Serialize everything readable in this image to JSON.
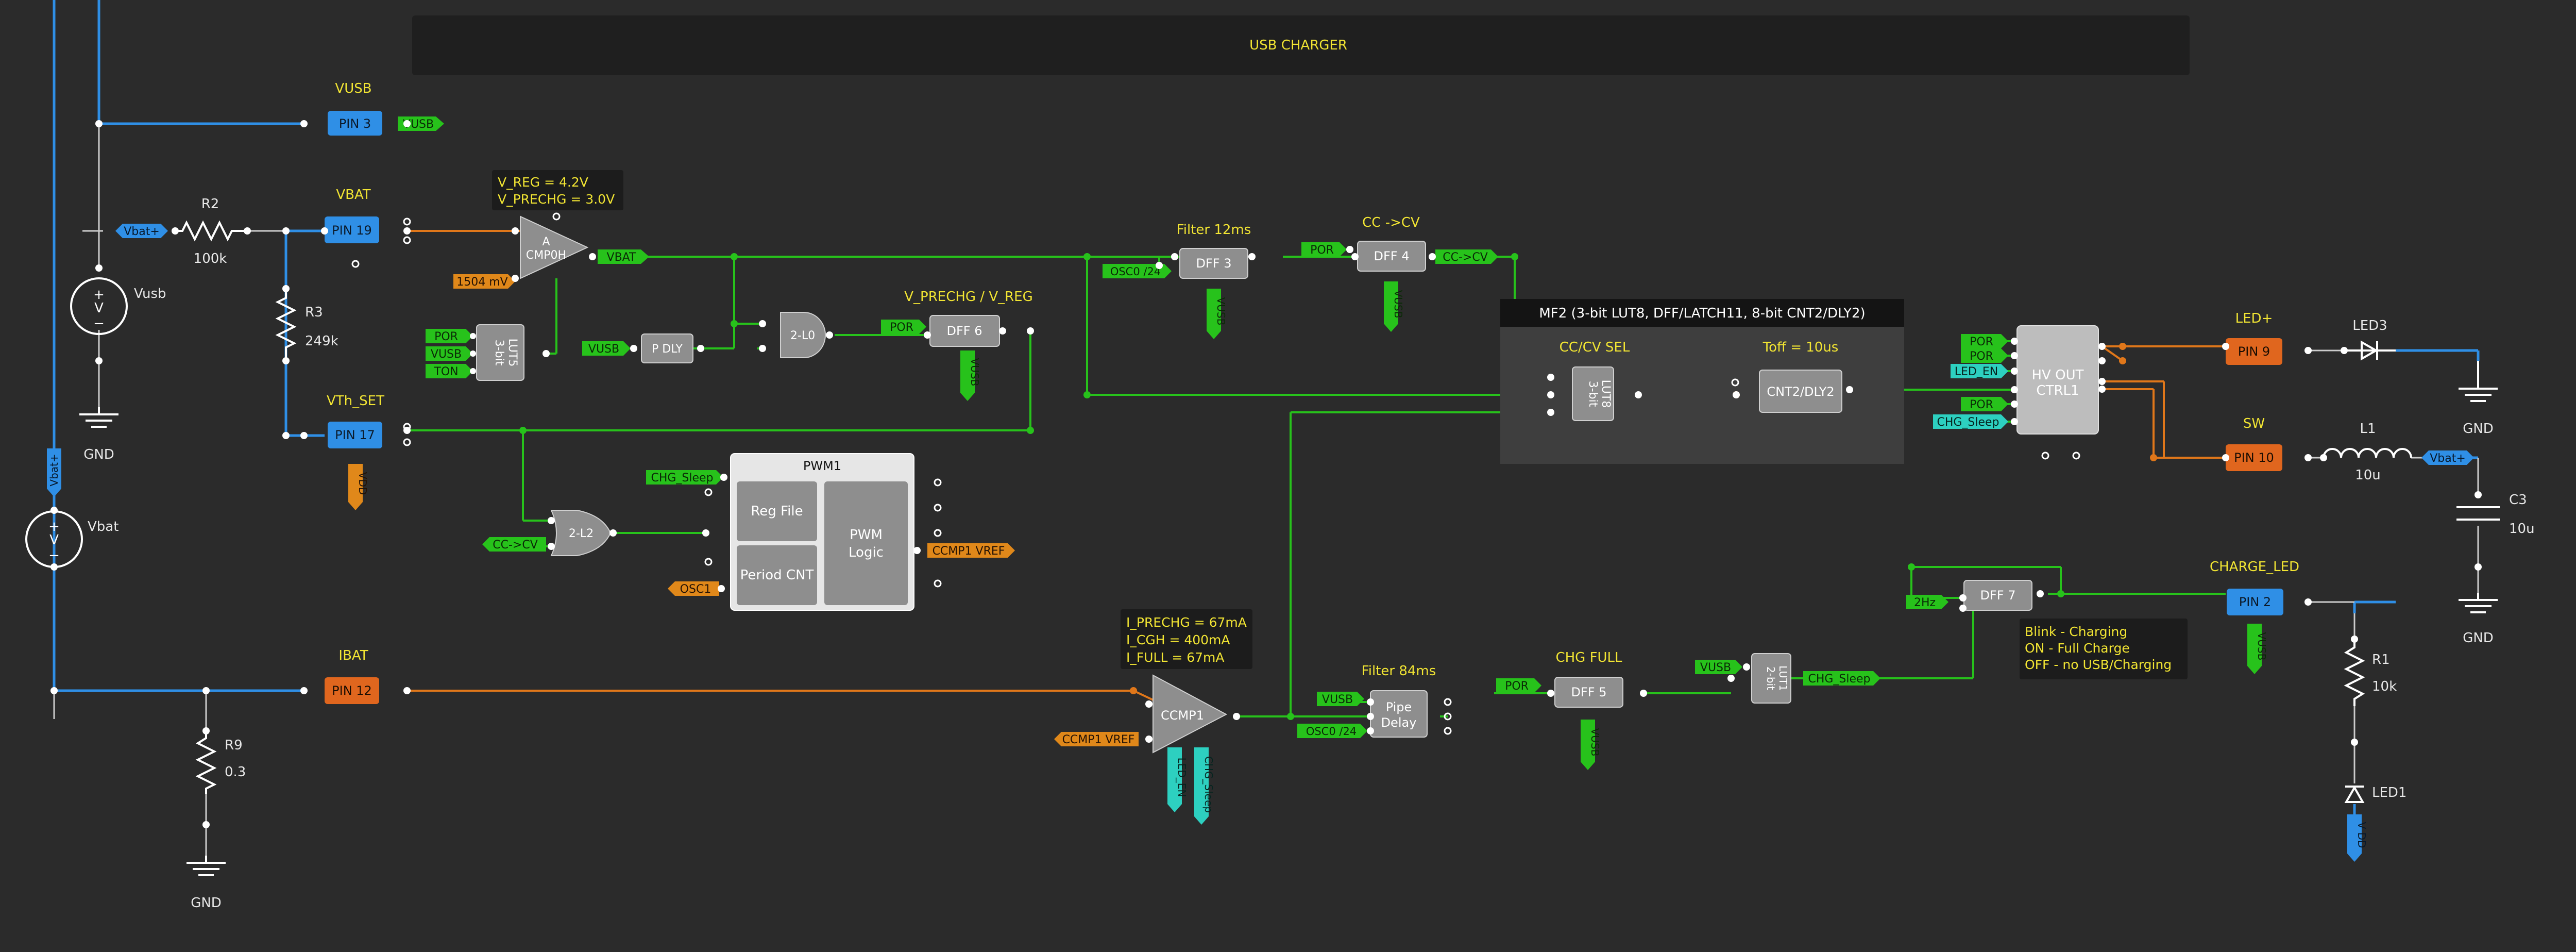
{
  "colors": {
    "background": "#2b2b2b",
    "wire_blue": "#2f8fe6",
    "wire_green": "#27c21b",
    "wire_orange": "#e0771a",
    "pin_blue": "#2f8fe6",
    "pin_orange": "#e0661e",
    "label_yellow": "#f2e533",
    "block_gray": "#8e8e8e"
  },
  "banner": {
    "title": "USB CHARGER"
  },
  "pins": {
    "pin3": {
      "label": "PIN 3",
      "name": "VUSB"
    },
    "pin19": {
      "label": "PIN 19",
      "name": "VBAT"
    },
    "pin17": {
      "label": "PIN 17",
      "name": "VTh_SET"
    },
    "pin12": {
      "label": "PIN 12",
      "name": "IBAT"
    },
    "pin9": {
      "label": "PIN 9",
      "name": "LED+"
    },
    "pin10": {
      "label": "PIN 10",
      "name": "SW"
    },
    "pin2": {
      "label": "PIN 2",
      "name": "CHARGE_LED"
    }
  },
  "tags": {
    "vusb_pin3": "VUSB",
    "vbat_plus_left": "Vbat+",
    "vbat_plus_vertical": "Vbat+",
    "vdd_pin17": "VDD",
    "ref_1504": "1504 mV",
    "vbat_out": "VBAT",
    "por_lut5": "POR",
    "vusb_lut5": "VUSB",
    "ton_lut5": "TON",
    "vusb_pdly": "VUSB",
    "por_dff6": "POR",
    "vusb_dff6": "VUSB",
    "osc0_dff3": "OSC0 /24",
    "vusb_dff3": "VUSB",
    "por_dff4": "POR",
    "vusb_dff4": "VUSB",
    "cccv_out": "CC->CV",
    "chg_sleep_pwm": "CHG_Sleep",
    "cccv_2l2": "CC->CV",
    "osc1_pwm": "OSC1",
    "ccmp1_vref_out": "CCMP1 VREF",
    "ccmp1_vref_in": "CCMP1 VREF",
    "led_en_ccmp": "LED_EN",
    "chg_sleep_ccmp": "CHG_Sleep",
    "vusb_pipe": "VUSB",
    "osc0_pipe": "OSC0 /24",
    "por_dff5": "POR",
    "vusb_dff5": "VUSB",
    "vusb_lut1": "VUSB",
    "chg_sleep_lut1": "CHG_Sleep",
    "hz_dff7": "2Hz",
    "vusb_pin2": "VUSB",
    "vdd_led1": "V DD",
    "por_hv1": "POR",
    "por_hv2": "POR",
    "led_en_hv": "LED_EN",
    "por_hv3": "POR",
    "chg_sleep_hv": "CHG_Sleep",
    "vbat_plus_right": "Vbat+"
  },
  "blocks": {
    "acmp0h_a": "A",
    "acmp0h_b": "CMP0H",
    "lut5_a": "3-bit",
    "lut5_b": "LUT5",
    "pdly": "P DLY",
    "l0": "2-L0",
    "dff6": "DFF 6",
    "dff3": "DFF 3",
    "dff4": "DFF 4",
    "l2": "2-L2",
    "pwm_title": "PWM1",
    "pwm_regfile": "Reg File",
    "pwm_periodcnt": "Period CNT",
    "pwm_logic_a": "PWM",
    "pwm_logic_b": "Logic",
    "ccmp1": "CCMP1",
    "pipe_a": "Pipe",
    "pipe_b": "Delay",
    "dff5": "DFF 5",
    "lut1_a": "2-bit",
    "lut1_b": "LUT1",
    "dff7": "DFF 7",
    "mf2_title": "MF2 (3-bit LUT8, DFF/LATCH11, 8-bit CNT2/DLY2)",
    "lut8_a": "3-bit",
    "lut8_b": "LUT8",
    "cnt2": "CNT2/DLY2",
    "hv_a": "HV OUT",
    "hv_b": "CTRL1"
  },
  "annotations": {
    "vreg": "V_REG = 4.2V",
    "vprechg_note": "V_PRECHG = 3.0V",
    "filter12": "Filter 12ms",
    "cccv_title": "CC ->CV",
    "vprechg_vreg": "V_PRECHG / V_REG",
    "cccv_sel": "CC/CV SEL",
    "toff": "Toff = 10us",
    "iprechg": "I_PRECHG = 67mA",
    "icgh": "I_CGH = 400mA",
    "ifull": "I_FULL = 67mA",
    "filter84": "Filter 84ms",
    "chgfull": "CHG FULL",
    "blink1": "Blink - Charging",
    "blink2": "ON - Full Charge",
    "blink3": "OFF - no USB/Charging"
  },
  "components": {
    "vusb_source": "Vusb",
    "vbat_source": "Vbat",
    "gnd_left": "GND",
    "r2_name": "R2",
    "r2_value": "100k",
    "r3_name": "R3",
    "r3_value": "249k",
    "r9_name": "R9",
    "r9_value": "0.3",
    "gnd_r9": "GND",
    "led3": "LED3",
    "gnd_led3": "GND",
    "l1_name": "L1",
    "l1_value": "10u",
    "c3_name": "C3",
    "c3_value": "10u",
    "gnd_c3": "GND",
    "r1_name": "R1",
    "r1_value": "10k",
    "led1": "LED1"
  }
}
